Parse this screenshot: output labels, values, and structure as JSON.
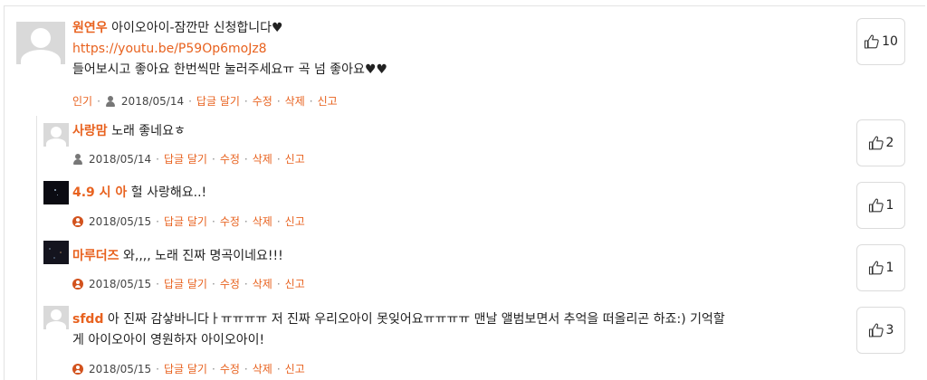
{
  "comments": [
    {
      "author": "원연우",
      "text": "아이오아이-잠깐만 신청합니다♥",
      "link": "https://youtu.be/P59Op6moJz8",
      "text2": "들어보시고 좋아요 한번씩만 눌러주세요ㅠ 곡 넘 좋아요♥♥",
      "badge": "인기",
      "date": "2018/05/14",
      "likes": "10"
    },
    {
      "author": "사랑맘",
      "text": "노래 좋네요ㅎ",
      "date": "2018/05/14",
      "likes": "2"
    },
    {
      "author": "4.9 시 아",
      "text": "헐 사랑해요..!",
      "date": "2018/05/15",
      "likes": "1"
    },
    {
      "author": "마루더즈",
      "text": "와,,,, 노래 진짜 명곡이네요!!!",
      "date": "2018/05/15",
      "likes": "1"
    },
    {
      "author": "sfdd",
      "text": "아 진짜 감샇바니다ㅏㅠㅠㅠㅠ 저 진짜 우리오아이 못잊어요ㅠㅠㅠㅠ 맨날 앨범보면서 추억을 떠올리곤 하죠:) 기억할",
      "text2": "게 아이오아이 영원하자 아이오아이!",
      "date": "2018/05/15",
      "likes": "3"
    }
  ],
  "actions": {
    "reply": "답글 달기",
    "edit": "수정",
    "delete": "삭제",
    "report": "신고"
  },
  "colors": {
    "accent": "#e8621f",
    "border": "#dcdcdc"
  }
}
